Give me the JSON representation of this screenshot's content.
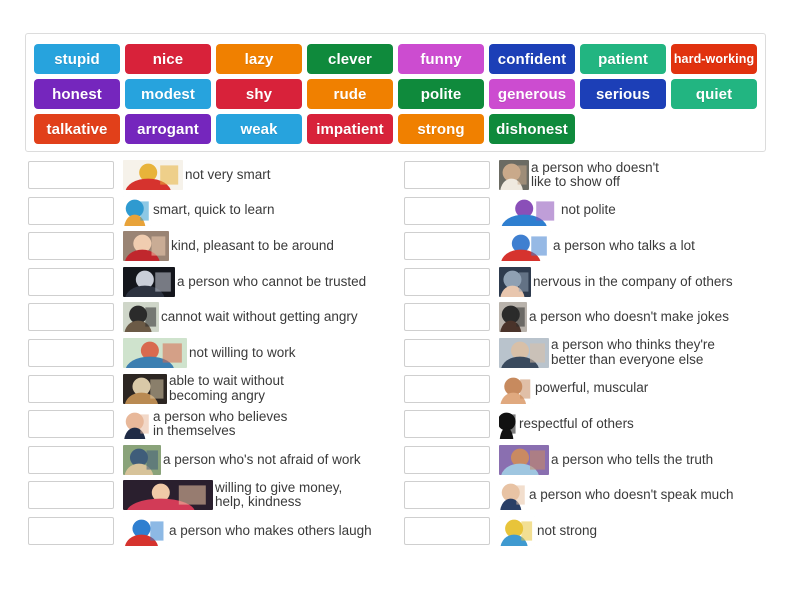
{
  "tile_bank": {
    "rows": [
      [
        {
          "label": "stupid",
          "color": "#27a3dd"
        },
        {
          "label": "nice",
          "color": "#d8223a"
        },
        {
          "label": "lazy",
          "color": "#f08000"
        },
        {
          "label": "clever",
          "color": "#0f8a3c"
        },
        {
          "label": "funny",
          "color": "#c martin"
        }
      ]
    ]
  },
  "tiles": {
    "row1": [
      {
        "label": "stupid",
        "color": "#27a3dd",
        "text_color": "#ffffff"
      },
      {
        "label": "nice",
        "color": "#d8223a",
        "text_color": "#ffffff"
      },
      {
        "label": "lazy",
        "color": "#f08000",
        "text_color": "#ffffff"
      },
      {
        "label": "clever",
        "color": "#0f8a3c",
        "text_color": "#ffffff"
      },
      {
        "label": "funny",
        "color": "#cc4cd0",
        "text_color": "#ffffff"
      },
      {
        "label": "confident",
        "color": "#1c3fb7",
        "text_color": "#ffffff"
      },
      {
        "label": "patient",
        "color": "#22b581",
        "text_color": "#ffffff"
      },
      {
        "label": "hard-working",
        "color": "#e1320f",
        "text_color": "#ffffff",
        "small": true
      }
    ],
    "row2": [
      {
        "label": "honest",
        "color": "#7526bd",
        "text_color": "#ffffff"
      },
      {
        "label": "modest",
        "color": "#27a3dd",
        "text_color": "#ffffff"
      },
      {
        "label": "shy",
        "color": "#d8223a",
        "text_color": "#ffffff"
      },
      {
        "label": "rude",
        "color": "#f08000",
        "text_color": "#ffffff"
      },
      {
        "label": "polite",
        "color": "#0f8a3c",
        "text_color": "#ffffff"
      },
      {
        "label": "generous",
        "color": "#cc4cd0",
        "text_color": "#ffffff"
      },
      {
        "label": "serious",
        "color": "#1c3fb7",
        "text_color": "#ffffff"
      },
      {
        "label": "quiet",
        "color": "#22b581",
        "text_color": "#ffffff"
      }
    ],
    "row3": [
      {
        "label": "talkative",
        "color": "#e1401a",
        "text_color": "#ffffff"
      },
      {
        "label": "arrogant",
        "color": "#7526bd",
        "text_color": "#ffffff"
      },
      {
        "label": "weak",
        "color": "#27a3dd",
        "text_color": "#ffffff"
      },
      {
        "label": "impatient",
        "color": "#d8223a",
        "text_color": "#ffffff"
      },
      {
        "label": "strong",
        "color": "#f08000",
        "text_color": "#ffffff"
      },
      {
        "label": "dishonest",
        "color": "#0f8a3c",
        "text_color": "#ffffff"
      }
    ]
  },
  "left_column": [
    {
      "answer": "",
      "image": "failed-test-paper-image",
      "thumb_w": 60,
      "text": "not very smart"
    },
    {
      "answer": "",
      "image": "boy-with-idea-lightbulb-image",
      "thumb_w": 28,
      "text": "smart, quick to learn"
    },
    {
      "answer": "",
      "image": "smiling-woman-red-scarf-image",
      "thumb_w": 46,
      "text": "kind, pleasant to be around"
    },
    {
      "answer": "",
      "image": "man-in-suit-hiding-image",
      "thumb_w": 52,
      "text": "a person who cannot be trusted"
    },
    {
      "answer": "",
      "image": "child-waiting-with-clock-image",
      "thumb_w": 36,
      "text": "cannot wait without getting angry"
    },
    {
      "answer": "",
      "image": "man-lying-on-couch-image",
      "thumb_w": 64,
      "text": "not willing to work"
    },
    {
      "answer": "",
      "image": "hourglass-and-boy-image",
      "thumb_w": 44,
      "text": "able to wait without\nbecoming angry"
    },
    {
      "answer": "",
      "image": "confident-businesswoman-image",
      "thumb_w": 28,
      "text": "a person who believes\nin themselves"
    },
    {
      "answer": "",
      "image": "people-working-outdoors-image",
      "thumb_w": 38,
      "text": "a person who's not afraid of work"
    },
    {
      "answer": "",
      "image": "hands-giving-gift-image",
      "thumb_w": 90,
      "text": "willing to give money,\nhelp, kindness"
    },
    {
      "answer": "",
      "image": "three-laughing-children-image",
      "thumb_w": 44,
      "text": "a person who makes others laugh"
    }
  ],
  "right_column": [
    {
      "answer": "",
      "image": "modest-woman-with-book-image",
      "thumb_w": 30,
      "text": "a person who doesn't\nlike to show off"
    },
    {
      "answer": "",
      "image": "rude-cartoon-people-image",
      "thumb_w": 60,
      "text": "not polite"
    },
    {
      "answer": "",
      "image": "cartoon-boy-talking-a-lot-image",
      "thumb_w": 52,
      "text": "a person who talks a lot"
    },
    {
      "answer": "",
      "image": "shy-child-hiding-image",
      "thumb_w": 32,
      "text": "nervous in the company of others"
    },
    {
      "answer": "",
      "image": "serious-man-portrait-image",
      "thumb_w": 28,
      "text": "a person who doesn't make jokes"
    },
    {
      "answer": "",
      "image": "arrogant-businessman-image",
      "thumb_w": 50,
      "text": "a person who thinks they're\n  better than everyone else"
    },
    {
      "answer": "",
      "image": "flexed-biceps-arm-image",
      "thumb_w": 34,
      "text": "powerful, muscular"
    },
    {
      "answer": "",
      "image": "bowing-person-silhouette-image",
      "thumb_w": 18,
      "text": "respectful of others"
    },
    {
      "answer": "",
      "image": "man-telling-truth-image",
      "thumb_w": 50,
      "text": "a person who tells the truth"
    },
    {
      "answer": "",
      "image": "quiet-woman-finger-on-lips-image",
      "thumb_w": 28,
      "text": "a person who doesn't speak much"
    },
    {
      "answer": "",
      "image": "weak-cartoon-person-image",
      "thumb_w": 36,
      "text": "not strong"
    }
  ]
}
